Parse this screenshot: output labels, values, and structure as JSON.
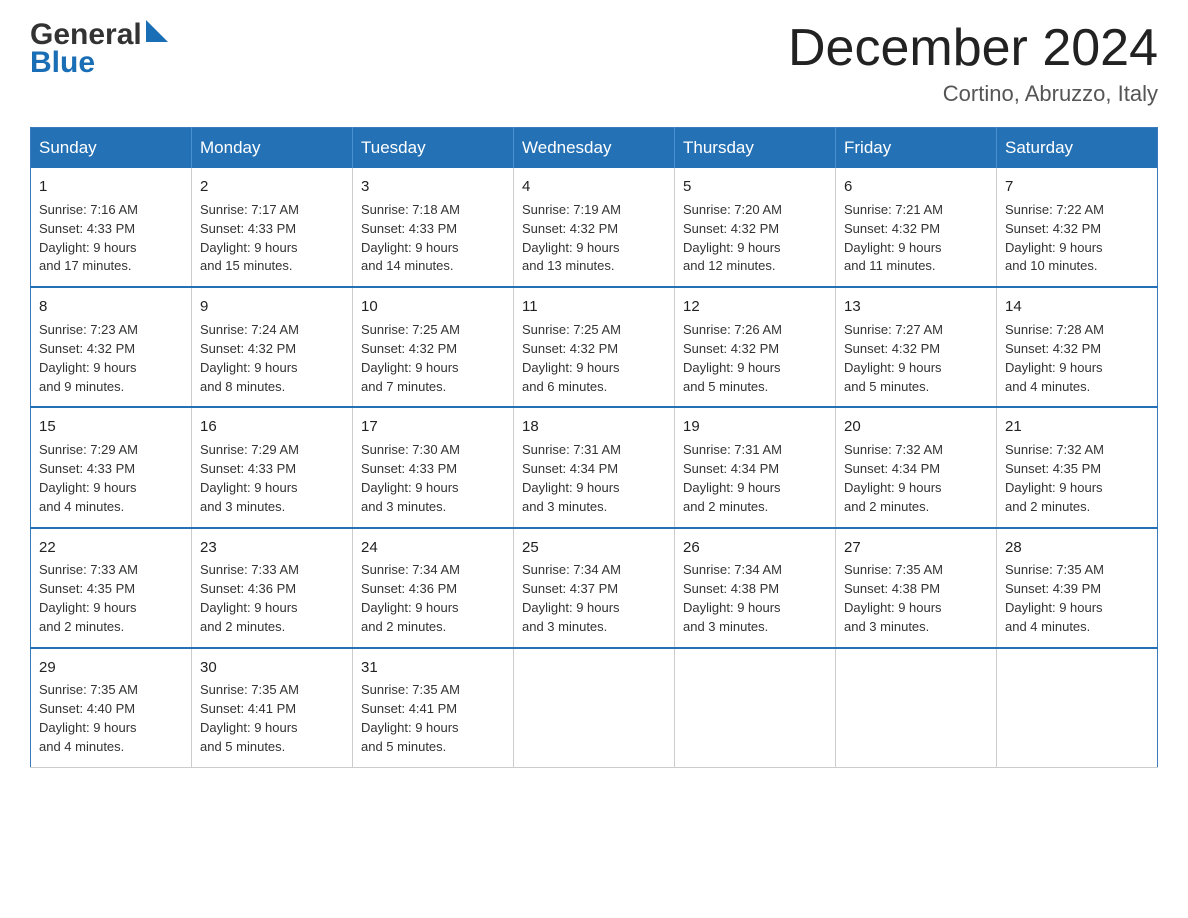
{
  "header": {
    "logo_general": "General",
    "logo_blue": "Blue",
    "month_title": "December 2024",
    "location": "Cortino, Abruzzo, Italy"
  },
  "weekdays": [
    "Sunday",
    "Monday",
    "Tuesday",
    "Wednesday",
    "Thursday",
    "Friday",
    "Saturday"
  ],
  "weeks": [
    [
      {
        "day": "1",
        "sunrise": "7:16 AM",
        "sunset": "4:33 PM",
        "daylight": "9 hours and 17 minutes."
      },
      {
        "day": "2",
        "sunrise": "7:17 AM",
        "sunset": "4:33 PM",
        "daylight": "9 hours and 15 minutes."
      },
      {
        "day": "3",
        "sunrise": "7:18 AM",
        "sunset": "4:33 PM",
        "daylight": "9 hours and 14 minutes."
      },
      {
        "day": "4",
        "sunrise": "7:19 AM",
        "sunset": "4:32 PM",
        "daylight": "9 hours and 13 minutes."
      },
      {
        "day": "5",
        "sunrise": "7:20 AM",
        "sunset": "4:32 PM",
        "daylight": "9 hours and 12 minutes."
      },
      {
        "day": "6",
        "sunrise": "7:21 AM",
        "sunset": "4:32 PM",
        "daylight": "9 hours and 11 minutes."
      },
      {
        "day": "7",
        "sunrise": "7:22 AM",
        "sunset": "4:32 PM",
        "daylight": "9 hours and 10 minutes."
      }
    ],
    [
      {
        "day": "8",
        "sunrise": "7:23 AM",
        "sunset": "4:32 PM",
        "daylight": "9 hours and 9 minutes."
      },
      {
        "day": "9",
        "sunrise": "7:24 AM",
        "sunset": "4:32 PM",
        "daylight": "9 hours and 8 minutes."
      },
      {
        "day": "10",
        "sunrise": "7:25 AM",
        "sunset": "4:32 PM",
        "daylight": "9 hours and 7 minutes."
      },
      {
        "day": "11",
        "sunrise": "7:25 AM",
        "sunset": "4:32 PM",
        "daylight": "9 hours and 6 minutes."
      },
      {
        "day": "12",
        "sunrise": "7:26 AM",
        "sunset": "4:32 PM",
        "daylight": "9 hours and 5 minutes."
      },
      {
        "day": "13",
        "sunrise": "7:27 AM",
        "sunset": "4:32 PM",
        "daylight": "9 hours and 5 minutes."
      },
      {
        "day": "14",
        "sunrise": "7:28 AM",
        "sunset": "4:32 PM",
        "daylight": "9 hours and 4 minutes."
      }
    ],
    [
      {
        "day": "15",
        "sunrise": "7:29 AM",
        "sunset": "4:33 PM",
        "daylight": "9 hours and 4 minutes."
      },
      {
        "day": "16",
        "sunrise": "7:29 AM",
        "sunset": "4:33 PM",
        "daylight": "9 hours and 3 minutes."
      },
      {
        "day": "17",
        "sunrise": "7:30 AM",
        "sunset": "4:33 PM",
        "daylight": "9 hours and 3 minutes."
      },
      {
        "day": "18",
        "sunrise": "7:31 AM",
        "sunset": "4:34 PM",
        "daylight": "9 hours and 3 minutes."
      },
      {
        "day": "19",
        "sunrise": "7:31 AM",
        "sunset": "4:34 PM",
        "daylight": "9 hours and 2 minutes."
      },
      {
        "day": "20",
        "sunrise": "7:32 AM",
        "sunset": "4:34 PM",
        "daylight": "9 hours and 2 minutes."
      },
      {
        "day": "21",
        "sunrise": "7:32 AM",
        "sunset": "4:35 PM",
        "daylight": "9 hours and 2 minutes."
      }
    ],
    [
      {
        "day": "22",
        "sunrise": "7:33 AM",
        "sunset": "4:35 PM",
        "daylight": "9 hours and 2 minutes."
      },
      {
        "day": "23",
        "sunrise": "7:33 AM",
        "sunset": "4:36 PM",
        "daylight": "9 hours and 2 minutes."
      },
      {
        "day": "24",
        "sunrise": "7:34 AM",
        "sunset": "4:36 PM",
        "daylight": "9 hours and 2 minutes."
      },
      {
        "day": "25",
        "sunrise": "7:34 AM",
        "sunset": "4:37 PM",
        "daylight": "9 hours and 3 minutes."
      },
      {
        "day": "26",
        "sunrise": "7:34 AM",
        "sunset": "4:38 PM",
        "daylight": "9 hours and 3 minutes."
      },
      {
        "day": "27",
        "sunrise": "7:35 AM",
        "sunset": "4:38 PM",
        "daylight": "9 hours and 3 minutes."
      },
      {
        "day": "28",
        "sunrise": "7:35 AM",
        "sunset": "4:39 PM",
        "daylight": "9 hours and 4 minutes."
      }
    ],
    [
      {
        "day": "29",
        "sunrise": "7:35 AM",
        "sunset": "4:40 PM",
        "daylight": "9 hours and 4 minutes."
      },
      {
        "day": "30",
        "sunrise": "7:35 AM",
        "sunset": "4:41 PM",
        "daylight": "9 hours and 5 minutes."
      },
      {
        "day": "31",
        "sunrise": "7:35 AM",
        "sunset": "4:41 PM",
        "daylight": "9 hours and 5 minutes."
      },
      null,
      null,
      null,
      null
    ]
  ],
  "labels": {
    "sunrise": "Sunrise:",
    "sunset": "Sunset:",
    "daylight": "Daylight:"
  }
}
